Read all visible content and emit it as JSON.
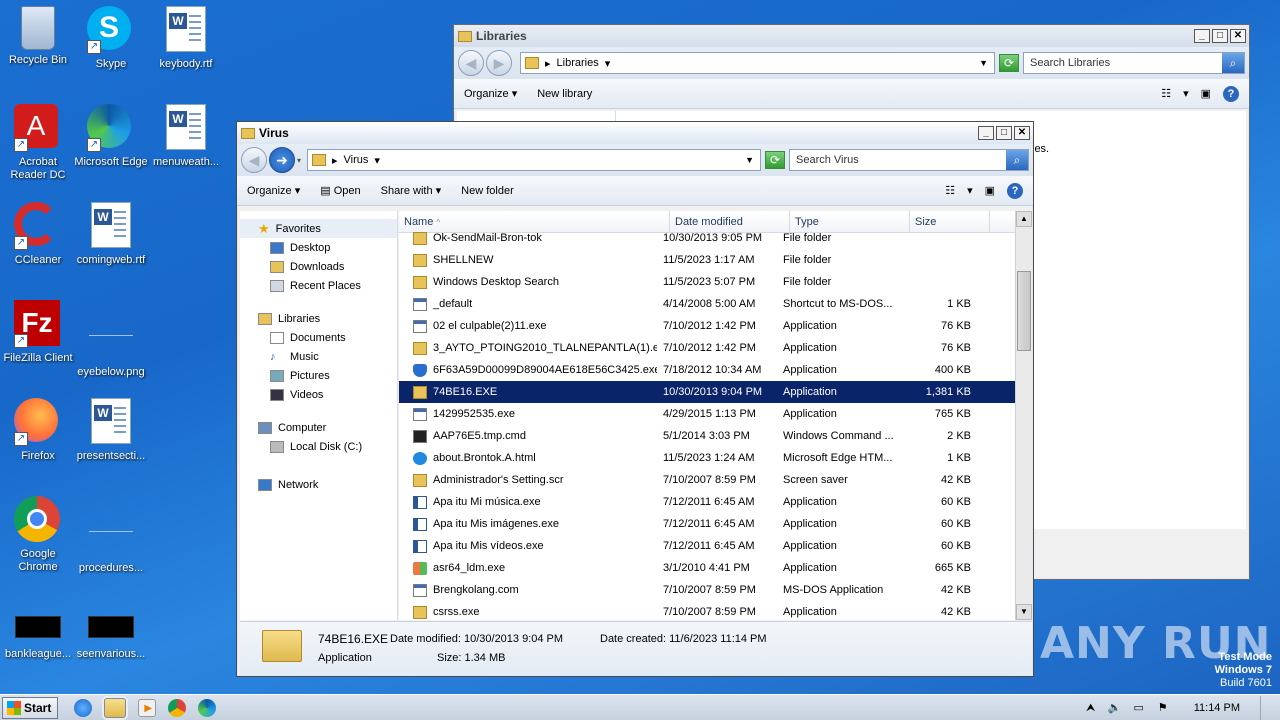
{
  "desktop": {
    "icons": [
      {
        "label": "Recycle Bin"
      },
      {
        "label": "Skype"
      },
      {
        "label": "keybody.rtf"
      },
      {
        "label": "Acrobat Reader DC"
      },
      {
        "label": "Microsoft Edge"
      },
      {
        "label": "menuweath..."
      },
      {
        "label": "CCleaner"
      },
      {
        "label": "comingweb.rtf"
      },
      {
        "label": "FileZilla Client"
      },
      {
        "label": "eyebelow.png"
      },
      {
        "label": "Firefox"
      },
      {
        "label": "presentsecti..."
      },
      {
        "label": "Google Chrome"
      },
      {
        "label": "procedures..."
      },
      {
        "label": "bankleague..."
      },
      {
        "label": "seenvarious..."
      }
    ]
  },
  "libraries_window": {
    "title": "Libraries",
    "address": "Libraries",
    "search_placeholder": "Search Libraries",
    "organize": "Organize",
    "new_library": "New library",
    "partial_text": "ies."
  },
  "virus_window": {
    "title": "Virus",
    "address": "Virus",
    "search_placeholder": "Search Virus",
    "commands": {
      "organize": "Organize",
      "open": "Open",
      "share_with": "Share with",
      "new_folder": "New folder"
    },
    "nav": {
      "favorites": "Favorites",
      "desktop": "Desktop",
      "downloads": "Downloads",
      "recent_places": "Recent Places",
      "libraries": "Libraries",
      "documents": "Documents",
      "music": "Music",
      "pictures": "Pictures",
      "videos": "Videos",
      "computer": "Computer",
      "local_disk": "Local Disk (C:)",
      "network": "Network"
    },
    "columns": {
      "name": "Name",
      "date": "Date modified",
      "type": "Type",
      "size": "Size"
    },
    "files": [
      {
        "name": "Ok-SendMail-Bron-tok",
        "date": "10/30/2013 9:05 PM",
        "type": "File folder",
        "size": "",
        "icon": "folder"
      },
      {
        "name": "SHELLNEW",
        "date": "11/5/2023 1:17 AM",
        "type": "File folder",
        "size": "",
        "icon": "folder"
      },
      {
        "name": "Windows Desktop Search",
        "date": "11/5/2023 5:07 PM",
        "type": "File folder",
        "size": "",
        "icon": "folder"
      },
      {
        "name": "_default",
        "date": "4/14/2008 5:00 AM",
        "type": "Shortcut to MS-DOS...",
        "size": "1 KB",
        "icon": "app"
      },
      {
        "name": "02 el culpable(2)11.exe",
        "date": "7/10/2012 1:42 PM",
        "type": "Application",
        "size": "76 KB",
        "icon": "app"
      },
      {
        "name": "3_AYTO_PTOING2010_TLALNEPANTLA(1).exe",
        "date": "7/10/2012 1:42 PM",
        "type": "Application",
        "size": "76 KB",
        "icon": "folder"
      },
      {
        "name": "6F63A59D00099D89004AE618E56C3425.exe",
        "date": "7/18/2012 10:34 AM",
        "type": "Application",
        "size": "400 KB",
        "icon": "shield"
      },
      {
        "name": "74BE16.EXE",
        "date": "10/30/2013 9:04 PM",
        "type": "Application",
        "size": "1,381 KB",
        "icon": "folder",
        "selected": true
      },
      {
        "name": "1429952535.exe",
        "date": "4/29/2015 1:13 PM",
        "type": "Application",
        "size": "765 KB",
        "icon": "app"
      },
      {
        "name": "AAP76E5.tmp.cmd",
        "date": "5/1/2014 3:03 PM",
        "type": "Windows Command ...",
        "size": "2 KB",
        "icon": "cmd"
      },
      {
        "name": "about.Brontok.A.html",
        "date": "11/5/2023 1:24 AM",
        "type": "Microsoft Edge HTM...",
        "size": "1 KB",
        "icon": "edge"
      },
      {
        "name": "Administrador's Setting.scr",
        "date": "7/10/2007 8:59 PM",
        "type": "Screen saver",
        "size": "42 KB",
        "icon": "folder"
      },
      {
        "name": "Apa itu Mi música.exe",
        "date": "7/12/2011 6:45 AM",
        "type": "Application",
        "size": "60 KB",
        "icon": "word"
      },
      {
        "name": "Apa itu Mis imágenes.exe",
        "date": "7/12/2011 6:45 AM",
        "type": "Application",
        "size": "60 KB",
        "icon": "word"
      },
      {
        "name": "Apa itu Mis vídeos.exe",
        "date": "7/12/2011 6:45 AM",
        "type": "Application",
        "size": "60 KB",
        "icon": "word"
      },
      {
        "name": "asr64_ldm.exe",
        "date": "3/1/2010 4:41 PM",
        "type": "Application",
        "size": "665 KB",
        "icon": "winflag"
      },
      {
        "name": "Brengkolang.com",
        "date": "7/10/2007 8:59 PM",
        "type": "MS-DOS Application",
        "size": "42 KB",
        "icon": "app"
      },
      {
        "name": "csrss.exe",
        "date": "7/10/2007 8:59 PM",
        "type": "Application",
        "size": "42 KB",
        "icon": "folder"
      }
    ],
    "details": {
      "name": "74BE16.EXE",
      "date_modified": "Date modified: 10/30/2013 9:04 PM",
      "date_created": "Date created: 11/6/2023 11:14 PM",
      "kind": "Application",
      "size": "Size: 1.34 MB"
    }
  },
  "taskbar": {
    "start": "Start",
    "clock": "11:14 PM"
  },
  "watermark": {
    "line1": "Test Mode",
    "line2": "Windows 7",
    "line3": "Build 7601",
    "brand": "ANY RUN"
  }
}
